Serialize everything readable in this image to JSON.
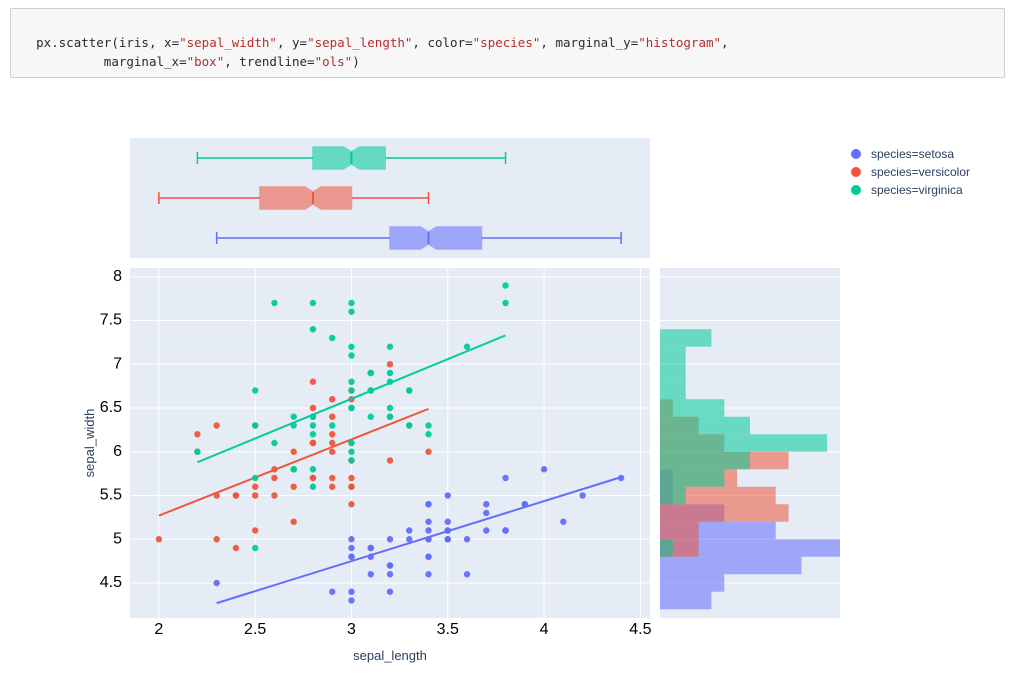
{
  "code": {
    "fn": "px.scatter",
    "obj": "iris",
    "args": [
      {
        "k": "x",
        "v": "\"sepal_width\""
      },
      {
        "k": "y",
        "v": "\"sepal_length\""
      },
      {
        "k": "color",
        "v": "\"species\""
      },
      {
        "k": "marginal_y",
        "v": "\"histogram\""
      },
      {
        "k": "marginal_x",
        "v": "\"box\""
      },
      {
        "k": "trendline",
        "v": "\"ols\""
      }
    ]
  },
  "legend": {
    "items": [
      {
        "label": "species=setosa",
        "color": "#636efa"
      },
      {
        "label": "species=versicolor",
        "color": "#ef553b"
      },
      {
        "label": "species=virginica",
        "color": "#00cc96"
      }
    ]
  },
  "axes": {
    "xlabel": "sepal_length",
    "ylabel": "sepal_width",
    "xticks": [
      2,
      2.5,
      3,
      3.5,
      4,
      4.5
    ],
    "yticks": [
      4.5,
      5,
      5.5,
      6,
      6.5,
      7,
      7.5,
      8
    ]
  },
  "chart_data": {
    "type": "scatter",
    "xlabel": "sepal_width",
    "ylabel": "sepal_length",
    "xlim": [
      1.85,
      4.55
    ],
    "ylim": [
      4.1,
      8.1
    ],
    "marginal_x": "box",
    "marginal_y": "histogram",
    "trendline": "ols",
    "series": [
      {
        "name": "setosa",
        "color": "#636efa",
        "points": [
          [
            3.5,
            5.1
          ],
          [
            3.0,
            4.9
          ],
          [
            3.2,
            4.7
          ],
          [
            3.1,
            4.6
          ],
          [
            3.6,
            5.0
          ],
          [
            3.9,
            5.4
          ],
          [
            3.4,
            4.6
          ],
          [
            3.4,
            5.0
          ],
          [
            2.9,
            4.4
          ],
          [
            3.1,
            4.9
          ],
          [
            3.7,
            5.4
          ],
          [
            3.4,
            4.8
          ],
          [
            3.0,
            4.8
          ],
          [
            3.0,
            4.3
          ],
          [
            4.0,
            5.8
          ],
          [
            4.4,
            5.7
          ],
          [
            3.9,
            5.4
          ],
          [
            3.5,
            5.1
          ],
          [
            3.8,
            5.7
          ],
          [
            3.8,
            5.1
          ],
          [
            3.4,
            5.4
          ],
          [
            3.7,
            5.1
          ],
          [
            3.6,
            4.6
          ],
          [
            3.3,
            5.1
          ],
          [
            3.4,
            4.8
          ],
          [
            3.0,
            5.0
          ],
          [
            3.4,
            5.0
          ],
          [
            3.5,
            5.2
          ],
          [
            3.4,
            5.2
          ],
          [
            3.2,
            4.7
          ],
          [
            3.1,
            4.8
          ],
          [
            3.4,
            5.4
          ],
          [
            4.1,
            5.2
          ],
          [
            4.2,
            5.5
          ],
          [
            3.1,
            4.9
          ],
          [
            3.2,
            5.0
          ],
          [
            3.5,
            5.5
          ],
          [
            3.1,
            4.9
          ],
          [
            3.0,
            4.4
          ],
          [
            3.4,
            5.1
          ],
          [
            3.5,
            5.0
          ],
          [
            2.3,
            4.5
          ],
          [
            3.2,
            4.4
          ],
          [
            3.5,
            5.0
          ],
          [
            3.8,
            5.1
          ],
          [
            3.0,
            4.8
          ],
          [
            3.8,
            5.1
          ],
          [
            3.2,
            4.6
          ],
          [
            3.7,
            5.3
          ],
          [
            3.3,
            5.0
          ]
        ],
        "trend": {
          "x0": 2.3,
          "y0": 4.27,
          "x1": 4.4,
          "y1": 5.71
        },
        "box": {
          "min": 2.3,
          "q1": 3.2,
          "med": 3.4,
          "q3": 3.675,
          "max": 4.4
        },
        "hist": {
          "bin_start": 4.2,
          "bin_size": 0.2,
          "counts": [
            4,
            5,
            11,
            14,
            9,
            5,
            1,
            1
          ]
        }
      },
      {
        "name": "versicolor",
        "color": "#ef553b",
        "points": [
          [
            3.2,
            7.0
          ],
          [
            3.2,
            6.4
          ],
          [
            3.1,
            6.9
          ],
          [
            2.3,
            5.5
          ],
          [
            2.8,
            6.5
          ],
          [
            2.8,
            5.7
          ],
          [
            3.3,
            6.3
          ],
          [
            2.4,
            4.9
          ],
          [
            2.9,
            6.6
          ],
          [
            2.7,
            5.2
          ],
          [
            2.0,
            5.0
          ],
          [
            3.0,
            5.9
          ],
          [
            2.2,
            6.0
          ],
          [
            2.9,
            6.1
          ],
          [
            2.9,
            5.6
          ],
          [
            3.1,
            6.7
          ],
          [
            3.0,
            5.6
          ],
          [
            2.7,
            5.8
          ],
          [
            2.2,
            6.2
          ],
          [
            2.5,
            5.6
          ],
          [
            3.2,
            5.9
          ],
          [
            2.8,
            6.1
          ],
          [
            2.5,
            6.3
          ],
          [
            2.8,
            6.1
          ],
          [
            2.9,
            6.4
          ],
          [
            3.0,
            6.6
          ],
          [
            2.8,
            6.8
          ],
          [
            3.0,
            6.7
          ],
          [
            2.9,
            6.0
          ],
          [
            2.6,
            5.7
          ],
          [
            2.4,
            5.5
          ],
          [
            2.4,
            5.5
          ],
          [
            2.7,
            5.8
          ],
          [
            2.7,
            6.0
          ],
          [
            3.0,
            5.4
          ],
          [
            3.4,
            6.0
          ],
          [
            3.1,
            6.7
          ],
          [
            2.3,
            6.3
          ],
          [
            3.0,
            5.6
          ],
          [
            2.5,
            5.5
          ],
          [
            2.6,
            5.5
          ],
          [
            3.0,
            6.1
          ],
          [
            2.6,
            5.8
          ],
          [
            2.3,
            5.0
          ],
          [
            2.7,
            5.6
          ],
          [
            3.0,
            5.7
          ],
          [
            2.9,
            5.7
          ],
          [
            2.9,
            6.2
          ],
          [
            2.5,
            5.1
          ],
          [
            2.8,
            5.7
          ]
        ],
        "trend": {
          "x0": 2.0,
          "y0": 5.27,
          "x1": 3.4,
          "y1": 6.49
        },
        "box": {
          "min": 2.0,
          "q1": 2.525,
          "med": 2.8,
          "q3": 3.0,
          "max": 3.4
        },
        "hist": {
          "bin_start": 4.8,
          "bin_size": 0.2,
          "counts": [
            3,
            3,
            10,
            9,
            6,
            10,
            5,
            3,
            1
          ]
        }
      },
      {
        "name": "virginica",
        "color": "#00cc96",
        "points": [
          [
            3.3,
            6.3
          ],
          [
            2.7,
            5.8
          ],
          [
            3.0,
            7.1
          ],
          [
            2.9,
            6.3
          ],
          [
            3.0,
            6.5
          ],
          [
            3.0,
            7.6
          ],
          [
            2.5,
            4.9
          ],
          [
            2.9,
            7.3
          ],
          [
            2.5,
            6.7
          ],
          [
            3.6,
            7.2
          ],
          [
            3.2,
            6.5
          ],
          [
            2.7,
            6.4
          ],
          [
            3.0,
            6.8
          ],
          [
            2.5,
            5.7
          ],
          [
            2.8,
            5.8
          ],
          [
            3.2,
            6.4
          ],
          [
            3.0,
            6.5
          ],
          [
            3.8,
            7.7
          ],
          [
            2.6,
            7.7
          ],
          [
            2.2,
            6.0
          ],
          [
            3.2,
            6.9
          ],
          [
            2.8,
            5.6
          ],
          [
            2.8,
            7.7
          ],
          [
            2.7,
            6.3
          ],
          [
            3.3,
            6.7
          ],
          [
            3.2,
            7.2
          ],
          [
            2.8,
            6.2
          ],
          [
            3.0,
            6.1
          ],
          [
            2.8,
            6.4
          ],
          [
            3.0,
            7.2
          ],
          [
            2.8,
            7.4
          ],
          [
            3.8,
            7.9
          ],
          [
            2.8,
            6.4
          ],
          [
            2.8,
            6.3
          ],
          [
            2.6,
            6.1
          ],
          [
            3.0,
            7.7
          ],
          [
            3.4,
            6.3
          ],
          [
            3.1,
            6.4
          ],
          [
            3.0,
            6.0
          ],
          [
            3.1,
            6.9
          ],
          [
            3.1,
            6.7
          ],
          [
            3.1,
            6.9
          ],
          [
            2.7,
            5.8
          ],
          [
            3.2,
            6.8
          ],
          [
            3.3,
            6.7
          ],
          [
            3.0,
            6.7
          ],
          [
            2.5,
            6.3
          ],
          [
            3.0,
            6.5
          ],
          [
            3.4,
            6.2
          ],
          [
            3.0,
            5.9
          ]
        ],
        "trend": {
          "x0": 2.2,
          "y0": 5.88,
          "x1": 3.8,
          "y1": 7.33
        },
        "box": {
          "min": 2.2,
          "q1": 2.8,
          "med": 3.0,
          "q3": 3.175,
          "max": 3.8
        },
        "hist": {
          "bin_start": 4.8,
          "bin_size": 0.2,
          "counts": [
            1,
            0,
            0,
            2,
            5,
            7,
            13,
            7,
            5,
            2,
            2,
            2,
            4
          ]
        }
      }
    ]
  }
}
